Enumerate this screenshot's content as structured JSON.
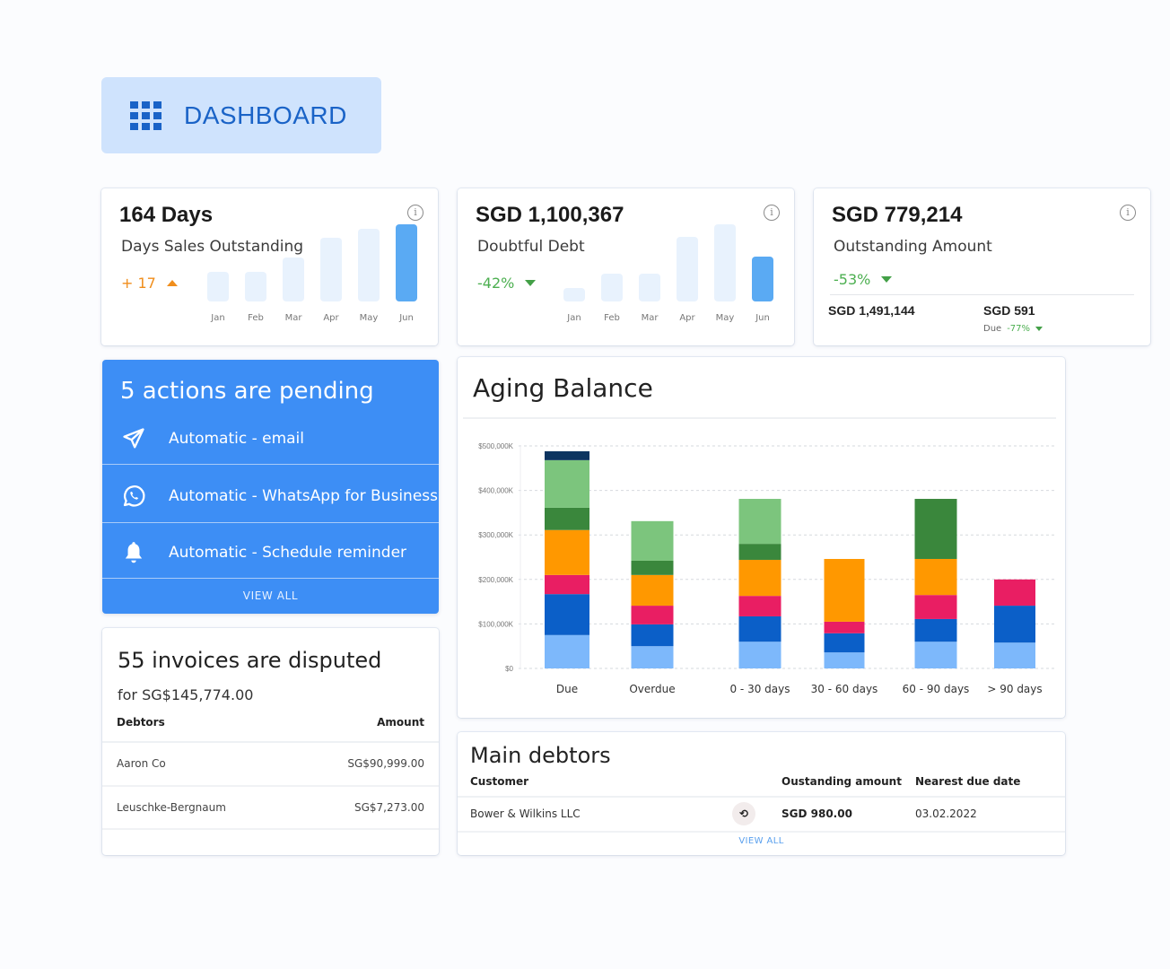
{
  "header": {
    "title": "DASHBOARD",
    "icon": "grid-icon"
  },
  "kpis": [
    {
      "value": "164 Days",
      "label": "Days Sales Outstanding",
      "delta": "+ 17",
      "delta_direction": "up",
      "months": [
        "Jan",
        "Feb",
        "Mar",
        "Apr",
        "May",
        "Jun"
      ],
      "trend": [
        0.38,
        0.38,
        0.57,
        0.82,
        0.94,
        1.0
      ],
      "active_month": "Jun"
    },
    {
      "value": "SGD 1,100,367",
      "label": "Doubtful Debt",
      "delta": "-42%",
      "delta_direction": "down",
      "months": [
        "Jan",
        "Feb",
        "Mar",
        "Apr",
        "May",
        "Jun"
      ],
      "trend": [
        0.17,
        0.36,
        0.36,
        0.84,
        1.0,
        0.58
      ],
      "active_month": "Jun"
    },
    {
      "value": "SGD 779,214",
      "label": "Outstanding Amount",
      "delta": "-53%",
      "delta_direction": "down",
      "secondary_left": "SGD 1,491,144",
      "secondary_right": "SGD 591",
      "due_label": "Due",
      "due_delta": "-77%"
    }
  ],
  "pending": {
    "title": "5 actions are pending",
    "items": [
      {
        "label": "Automatic - email",
        "icon": "send-icon"
      },
      {
        "label": "Automatic - WhatsApp for Business",
        "icon": "whatsapp-icon"
      },
      {
        "label": "Automatic - Schedule reminder",
        "icon": "bell-icon"
      }
    ],
    "view_all": "VIEW ALL"
  },
  "disputed": {
    "title": "55 invoices are disputed",
    "subtitle": "for SG$145,774.00",
    "columns": [
      "Debtors",
      "Amount"
    ],
    "rows": [
      {
        "debtor": "Aaron Co",
        "amount": "SG$90,999.00"
      },
      {
        "debtor": "Leuschke-Bergnaum",
        "amount": "SG$7,273.00"
      }
    ]
  },
  "aging": {
    "title": "Aging Balance"
  },
  "chart_data": {
    "type": "bar",
    "stacked": true,
    "title": "Aging Balance",
    "xlabel": "",
    "ylabel": "",
    "ylim": [
      0,
      500000
    ],
    "unit_suffix": "K",
    "yticks": [
      "$0",
      "$100,000K",
      "$200,000K",
      "$300,000K",
      "$400,000K",
      "$500,000K"
    ],
    "ytick_values": [
      0,
      100000,
      200000,
      300000,
      400000,
      500000
    ],
    "grid": true,
    "legend": "none",
    "categories": [
      "Due",
      "Overdue",
      "0 - 30 days",
      "30 - 60 days",
      "60 - 90 days",
      "> 90 days"
    ],
    "series": [
      {
        "name": "segment-1",
        "color": "#7db8fb",
        "values": [
          75000,
          50000,
          60000,
          36000,
          60000,
          58000
        ]
      },
      {
        "name": "segment-2",
        "color": "#0b5fc8",
        "values": [
          92000,
          49000,
          57000,
          43000,
          51000,
          83000
        ]
      },
      {
        "name": "segment-3",
        "color": "#e91e63",
        "values": [
          43000,
          42000,
          46000,
          26000,
          54000,
          59000
        ]
      },
      {
        "name": "segment-4",
        "color": "#ff9800",
        "values": [
          101000,
          69000,
          81000,
          141000,
          81000,
          0
        ]
      },
      {
        "name": "segment-5",
        "color": "#3a873c",
        "values": [
          50000,
          32000,
          36000,
          0,
          135000,
          0
        ]
      },
      {
        "name": "segment-6",
        "color": "#7cc57d",
        "values": [
          107000,
          89000,
          101000,
          0,
          0,
          0
        ]
      },
      {
        "name": "segment-7",
        "color": "#0d3560",
        "values": [
          20000,
          0,
          0,
          0,
          0,
          0
        ]
      }
    ]
  },
  "debtors": {
    "title": "Main debtors",
    "columns": [
      "Customer",
      "Oustanding amount",
      "Nearest due date"
    ],
    "rows": [
      {
        "customer": "Bower & Wilkins LLC",
        "status_icon": "sync-alert-icon",
        "amount": "SGD 980.00",
        "due_date": "03.02.2022"
      }
    ],
    "view_all": "VIEW ALL"
  },
  "colors": {
    "accent": "#3d8ef5",
    "badge_bg": "#cfe3fd",
    "badge_text": "#1a63c7",
    "delta_up": "#f08e1c",
    "delta_down": "#4caf50"
  }
}
